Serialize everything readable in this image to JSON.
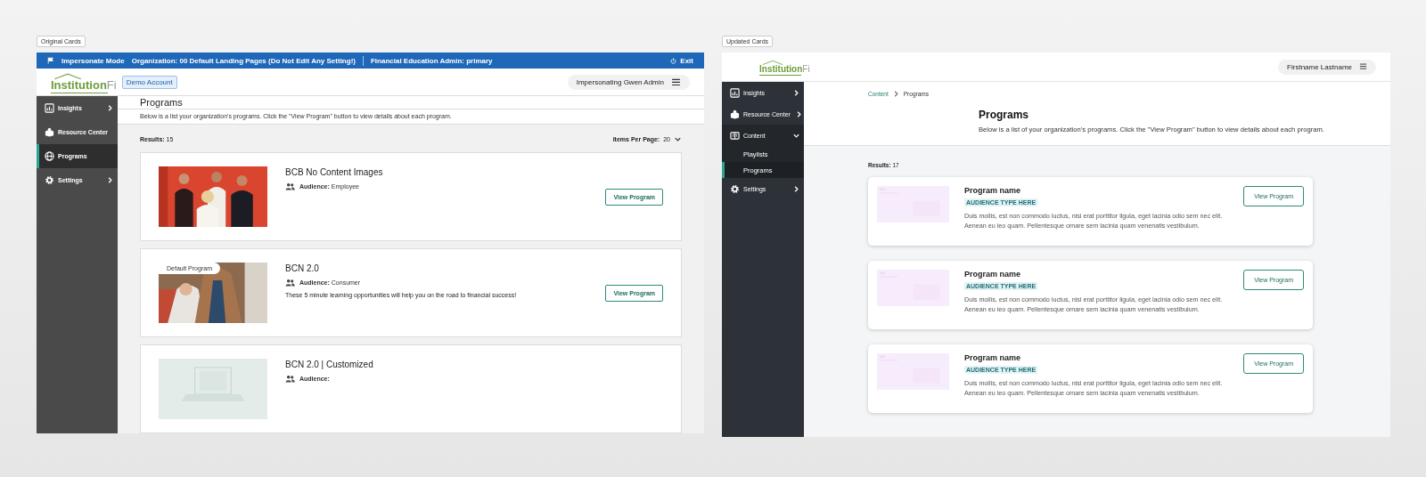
{
  "original": {
    "label": "Original Cards",
    "impersonate_bar": {
      "mode": "Impersonate Mode",
      "organization": "Organization: 00 Default Landing Pages (Do Not Edit Any Setting!)",
      "role": "Financial Education Admin: primary",
      "exit": "Exit"
    },
    "logo": {
      "name": "Institution",
      "suffix": "Fi"
    },
    "account_badge": "Demo Account",
    "user_menu": "Impersonating Gwen Admin",
    "sidebar": {
      "items": [
        {
          "label": "Insights",
          "expandable": true,
          "selected": false
        },
        {
          "label": "Resource Center",
          "expandable": false,
          "selected": false
        },
        {
          "label": "Programs",
          "expandable": false,
          "selected": true
        },
        {
          "label": "Settings",
          "expandable": true,
          "selected": false
        }
      ]
    },
    "title": "Programs",
    "description": "Below is a list your organization's programs. Click the \"View Program\" button to view details about each program.",
    "results_label": "Results:",
    "results_count": "15",
    "per_page_label": "Items Per Page:",
    "per_page_value": "20",
    "cards": [
      {
        "kind": "picture",
        "title": "BCB No Content Images",
        "audience_label": "Audience:",
        "audience": "Employee",
        "button": "View Program"
      },
      {
        "kind": "picture",
        "badge": "Default Program",
        "title": "BCN 2.0",
        "audience_label": "Audience:",
        "audience": "Consumer",
        "description": "These 5 minute learning opportunities will help you on the road to financial success!",
        "button": "View Program"
      },
      {
        "kind": "picture",
        "title": "BCN 2.0 | Customized",
        "audience_label": "Audience:"
      }
    ]
  },
  "updated": {
    "label": "Updated Cards",
    "logo": {
      "name": "Institution",
      "suffix": "Fi"
    },
    "user_menu": "Firstname Lastname",
    "sidebar": {
      "items": [
        {
          "label": "Insights",
          "expandable": true,
          "expanded": false
        },
        {
          "label": "Resource Center",
          "expandable": true,
          "expanded": false
        },
        {
          "label": "Content",
          "expandable": true,
          "expanded": true,
          "children": [
            {
              "label": "Playlists",
              "selected": false
            },
            {
              "label": "Programs",
              "selected": true
            }
          ]
        },
        {
          "label": "Settings",
          "expandable": true,
          "expanded": false
        }
      ]
    },
    "breadcrumb": [
      {
        "label": "Content",
        "link": true
      },
      {
        "label": "Programs",
        "link": false
      }
    ],
    "title": "Programs",
    "description": "Below is a list of your organization's programs. Click the \"View Program\" button to view details about each program.",
    "results_label": "Results:",
    "results_count": "17",
    "cards": [
      {
        "title": "Program name",
        "tag": "AUDIENCE TYPE HERE",
        "description": "Duis mollis, est non commodo luctus, nisi erat porttitor ligula, eget lacinia odio sem nec elit. Aenean eu leo quam. Pellentesque ornare sem lacinia quam venenatis vestibulum.",
        "button": "View Program"
      },
      {
        "title": "Program name",
        "tag": "AUDIENCE TYPE HERE",
        "description": "Duis mollis, est non commodo luctus, nisi erat porttitor ligula, eget lacinia odio sem nec elit. Aenean eu leo quam. Pellentesque ornare sem lacinia quam venenatis vestibulum.",
        "button": "View Program"
      },
      {
        "title": "Program name",
        "tag": "AUDIENCE TYPE HERE",
        "description": "Duis mollis, est non commodo luctus, nisi erat porttitor ligula, eget lacinia odio sem nec elit. Aenean eu leo quam. Pellentesque ornare sem lacinia quam venenatis vestibulum.",
        "button": "View Program"
      }
    ]
  }
}
